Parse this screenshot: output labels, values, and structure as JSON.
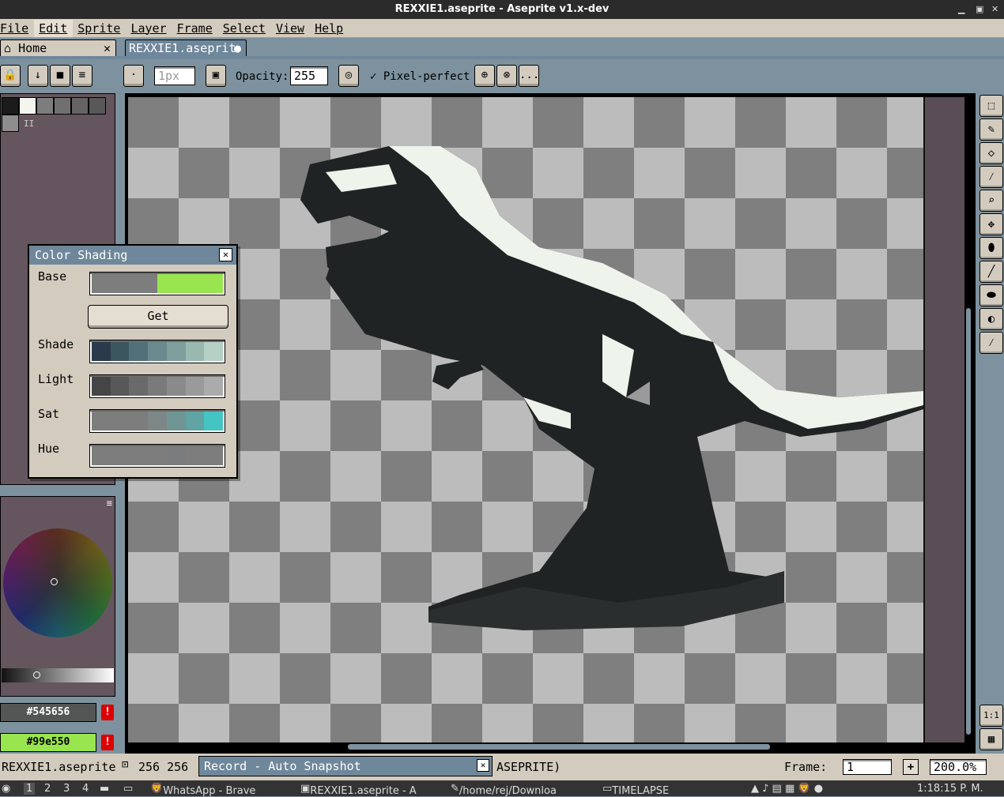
{
  "window": {
    "title": "REXXIE1.aseprite - Aseprite v1.x-dev"
  },
  "menu": [
    "File",
    "Edit",
    "Sprite",
    "Layer",
    "Frame",
    "Select",
    "View",
    "Help"
  ],
  "tabs": {
    "home": "Home",
    "file": "REXXIE1.aseprit"
  },
  "toolbar": {
    "brush_size": "1px",
    "opacity_label": "Opacity:",
    "opacity_value": "255",
    "pixel_perfect_label": "Pixel-perfect",
    "more": "..."
  },
  "palette": {
    "colors": [
      "#1b1b1b",
      "#f2f6ee",
      "#7d7d7d",
      "#707070",
      "#646464",
      "#585858",
      "#8e8e8e"
    ]
  },
  "colors": {
    "foreground": "#545656",
    "background": "#99e550"
  },
  "dialog": {
    "title": "Color Shading",
    "base_label": "Base",
    "get_button": "Get",
    "shade_label": "Shade",
    "light_label": "Light",
    "sat_label": "Sat",
    "hue_label": "Hue",
    "base_colors": [
      "#7d7d7d",
      "#99e550"
    ],
    "shade_colors": [
      "#2a3a4a",
      "#3c5660",
      "#52707a",
      "#6a8a90",
      "#7f9f9c",
      "#98b8b0",
      "#b5d0c4"
    ],
    "light_colors": [
      "#454545",
      "#585858",
      "#6a6a6a",
      "#7a7a7a",
      "#8a8a8a",
      "#9a9a9a",
      "#ababab"
    ],
    "sat_colors": [
      "#7d7d7d",
      "#7d7d7d",
      "#7d7d7d",
      "#7d8787",
      "#6f9595",
      "#60a4a4",
      "#45c4c4"
    ],
    "hue_colors": [
      "#7d7d7d",
      "#7d7d7d",
      "#7d7d7d",
      "#7d7d7d",
      "#7a7c7f",
      "#7d7d7d",
      "#7d7d7d"
    ]
  },
  "status": {
    "filename": "REXXIE1.aseprite",
    "size": "256  256",
    "record": "Record - Auto Snapshot",
    "path_fragment": "ASEPRITE)",
    "frame_label": "Frame:",
    "frame_value": "1",
    "zoom": "200.0%"
  },
  "taskbar": {
    "workspaces": [
      "1",
      "2",
      "3",
      "4"
    ],
    "apps": [
      "WhatsApp - Brave",
      "REXXIE1.aseprite - A",
      "/home/rej/Downloa",
      "TIMELAPSE"
    ],
    "clock": "1:18:15 P. M."
  }
}
